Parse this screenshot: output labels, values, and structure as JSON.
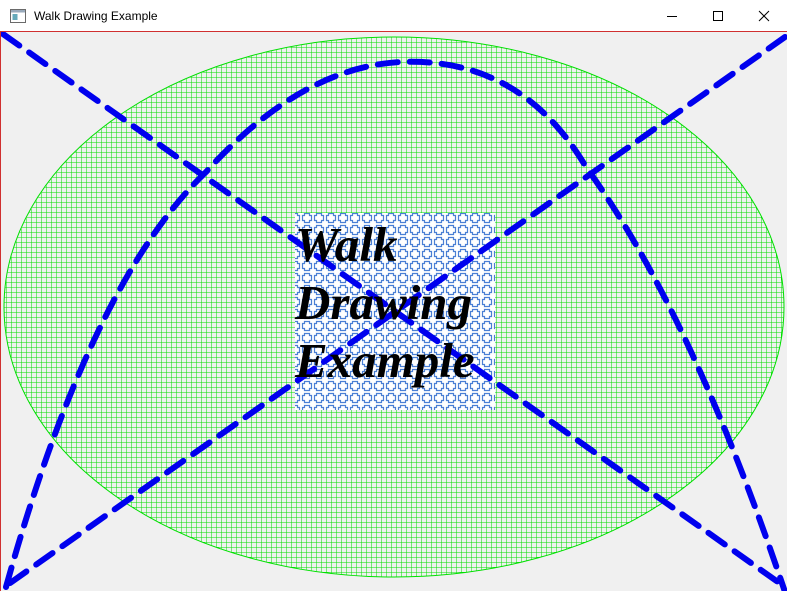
{
  "window": {
    "title": "Walk Drawing Example",
    "icon": "app-window-icon",
    "buttons": {
      "minimize": "minimize-icon",
      "maximize": "maximize-icon",
      "close": "close-icon"
    }
  },
  "drawing": {
    "text_lines": [
      "Walk",
      "Drawing",
      "Example"
    ],
    "colors": {
      "ellipse_grid": "#00e000",
      "dashed_lines": "#0000ee",
      "pattern_cross": "#4a7fd4",
      "pattern_bg": "#ffffff",
      "border": "#d03030",
      "background": "#f0f0f0"
    }
  }
}
